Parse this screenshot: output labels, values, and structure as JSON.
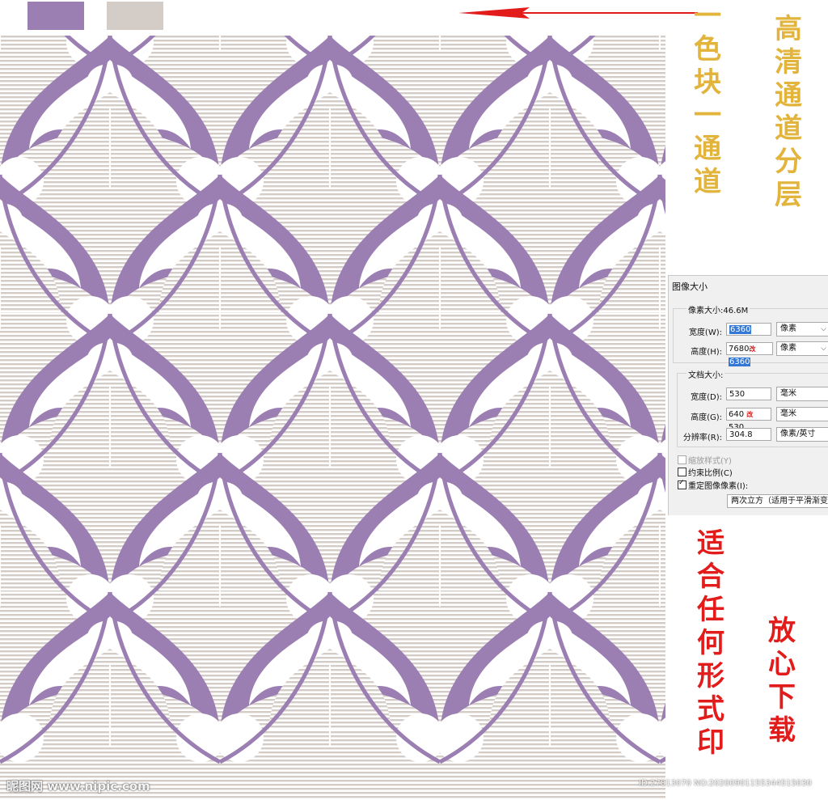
{
  "swatches": {
    "color1": "#9b7fb3",
    "color2": "#d3ccc7",
    "arrow_color": "#e21b1b"
  },
  "side_text": {
    "channel_note": "一色块一通道",
    "hd_layers": "高清通道分层",
    "print_note": "适合任何形式印",
    "download_note": "放心下载"
  },
  "dialog": {
    "title": "图像大小",
    "pixel_group": {
      "label": "像素大小:46.6M"
    },
    "width_label": "宽度(W):",
    "width_value": "6360",
    "width_unit": "像素",
    "height_label": "高度(H):",
    "height_old": "7680",
    "height_mark": "改",
    "height_value": "6360",
    "height_unit": "像素",
    "doc_group": {
      "label": "文档大小:"
    },
    "doc_width_label": "宽度(D):",
    "doc_width_value": "530",
    "doc_width_unit": "毫米",
    "doc_height_label": "高度(G):",
    "doc_height_old": "640",
    "doc_height_mark": "改",
    "doc_height_value": "530",
    "doc_height_unit": "毫米",
    "resolution_label": "分辨率(R):",
    "resolution_value": "304.8",
    "resolution_unit": "像素/英寸",
    "scale_styles": "缩放样式(Y)",
    "constrain": "约束比例(C)",
    "resample": "重定图像像素(I):",
    "resample_method": "两次立方（适用于平滑渐变"
  },
  "watermark": {
    "site": "昵图网 www.nipic.com",
    "id": "ID:27813070 NO:20200901155344515030"
  },
  "pattern": {
    "purple": "#9b7fb3",
    "beige": "#d3ccc7",
    "white": "#ffffff"
  }
}
